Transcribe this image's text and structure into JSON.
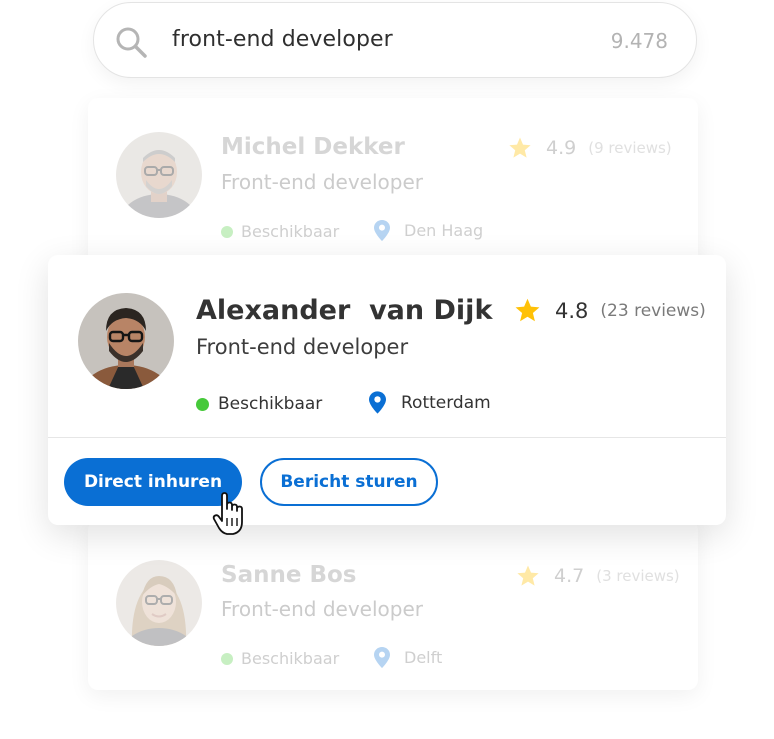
{
  "search": {
    "query": "front-end developer",
    "result_count": "9.478",
    "icon": "search-icon"
  },
  "colors": {
    "accent": "#0a6fd4",
    "available_dot": "#46c93a",
    "star": "#ffc107",
    "location_pin": "#0a6fd4"
  },
  "cards": [
    {
      "name": "Michel Dekker",
      "role": "Front-end developer",
      "rating": "4.9",
      "reviews": "(9 reviews)",
      "status": "Beschikbaar",
      "location": "Den Haag"
    },
    {
      "name": "Alexander  van Dijk",
      "role": "Front-end developer",
      "rating": "4.8",
      "reviews": "(23 reviews)",
      "status": "Beschikbaar",
      "location": "Rotterdam",
      "actions": {
        "hire": "Direct inhuren",
        "message": "Bericht sturen"
      }
    },
    {
      "name": "Sanne Bos",
      "role": "Front-end developer",
      "rating": "4.7",
      "reviews": "(3 reviews)",
      "status": "Beschikbaar",
      "location": "Delft"
    }
  ]
}
